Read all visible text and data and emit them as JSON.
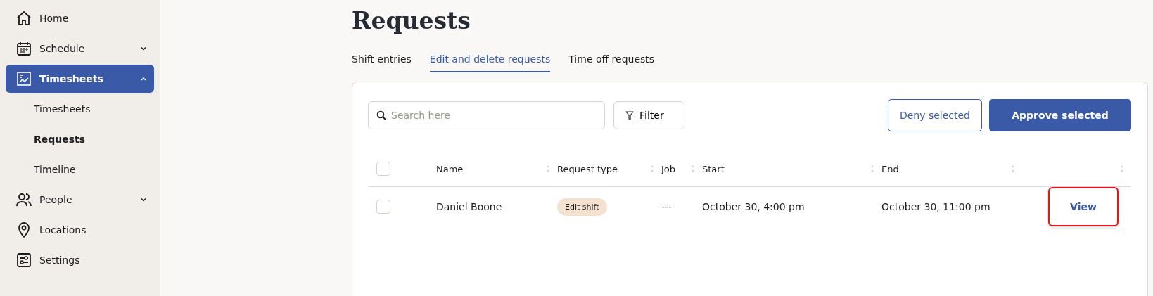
{
  "sidebar": {
    "items": [
      {
        "label": "Home",
        "selected": false
      },
      {
        "label": "Schedule",
        "selected": false,
        "expanded": false
      },
      {
        "label": "Timesheets",
        "selected": true,
        "expanded": true,
        "children": [
          {
            "label": "Timesheets",
            "selected": false
          },
          {
            "label": "Requests",
            "selected": true
          },
          {
            "label": "Timeline",
            "selected": false
          }
        ]
      },
      {
        "label": "People",
        "selected": false,
        "expanded": false
      },
      {
        "label": "Locations",
        "selected": false
      },
      {
        "label": "Settings",
        "selected": false
      }
    ]
  },
  "page": {
    "title": "Requests"
  },
  "tabs": [
    {
      "label": "Shift entries",
      "selected": false
    },
    {
      "label": "Edit and delete requests",
      "selected": true
    },
    {
      "label": "Time off requests",
      "selected": false
    }
  ],
  "toolbar": {
    "search": {
      "placeholder": "Search here"
    },
    "filter": "Filter",
    "deny": "Deny selected",
    "approve": "Approve selected"
  },
  "table": {
    "select_all": {
      "checked": false
    },
    "columns": [
      {
        "label": "Name"
      },
      {
        "label": "Request type"
      },
      {
        "label": "Job"
      },
      {
        "label": "Start"
      },
      {
        "label": "End"
      }
    ],
    "rows": [
      {
        "checked": false,
        "name": "Daniel Boone",
        "request_type": "Edit shift",
        "job": "---",
        "start": "October 30, 4:00 pm",
        "end": "October 30, 11:00 pm",
        "action": "View",
        "highlighted": true
      }
    ]
  }
}
